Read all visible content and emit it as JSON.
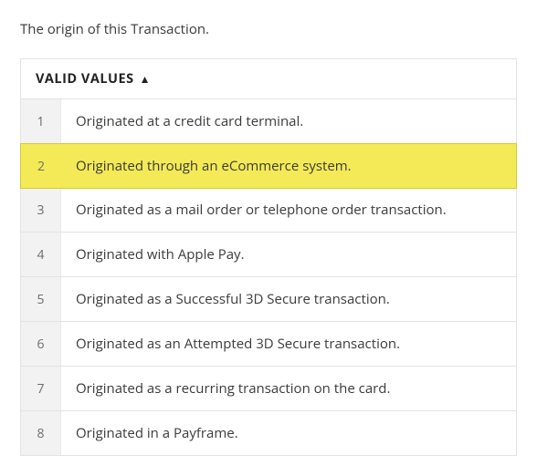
{
  "description": "The origin of this Transaction.",
  "table": {
    "headerLabel": "VALID VALUES",
    "rows": [
      {
        "num": "1",
        "text": "Originated at a credit card terminal.",
        "highlighted": false
      },
      {
        "num": "2",
        "text": "Originated through an eCommerce system.",
        "highlighted": true
      },
      {
        "num": "3",
        "text": "Originated as a mail order or telephone order transaction.",
        "highlighted": false
      },
      {
        "num": "4",
        "text": "Originated with Apple Pay.",
        "highlighted": false
      },
      {
        "num": "5",
        "text": "Originated as a Successful 3D Secure transaction.",
        "highlighted": false
      },
      {
        "num": "6",
        "text": "Originated as an Attempted 3D Secure transaction.",
        "highlighted": false
      },
      {
        "num": "7",
        "text": "Originated as a recurring transaction on the card.",
        "highlighted": false
      },
      {
        "num": "8",
        "text": "Originated in a Payframe.",
        "highlighted": false
      }
    ]
  }
}
